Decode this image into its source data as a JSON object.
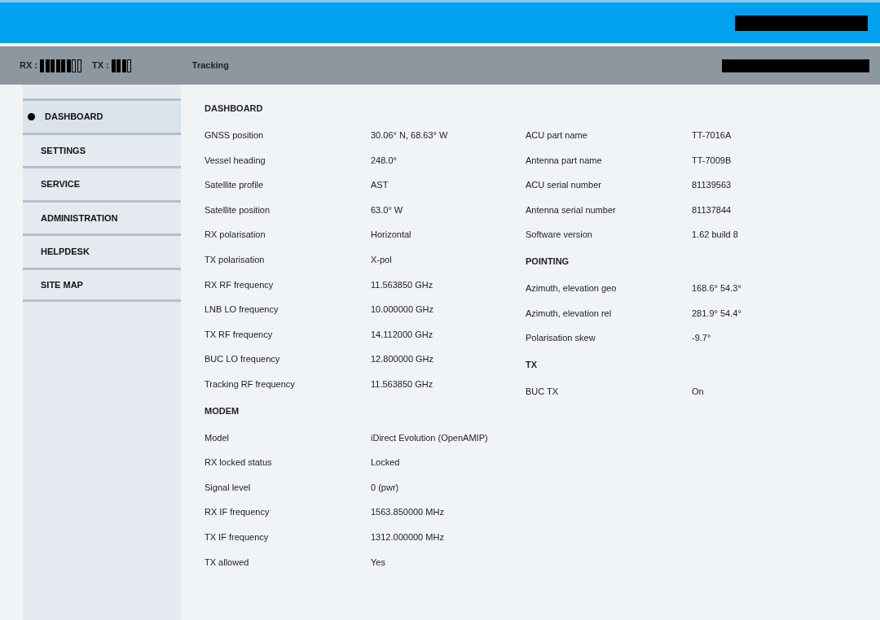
{
  "status_bar": {
    "meters": [
      {
        "label": "RX :",
        "segments": [
          {
            "filled": true
          },
          {
            "filled": true
          },
          {
            "filled": true
          },
          {
            "filled": true
          },
          {
            "filled": true
          },
          {
            "filled": true
          },
          {
            "filled": false
          },
          {
            "filled": false
          }
        ]
      },
      {
        "label": "TX :",
        "segments": [
          {
            "filled": true
          },
          {
            "filled": true
          },
          {
            "filled": true
          },
          {
            "filled": false
          }
        ]
      }
    ],
    "state": "Tracking"
  },
  "sidebar": {
    "items": [
      {
        "label": "DASHBOARD",
        "selected": true
      },
      {
        "label": "SETTINGS",
        "selected": false
      },
      {
        "label": "SERVICE",
        "selected": false
      },
      {
        "label": "ADMINISTRATION",
        "selected": false
      },
      {
        "label": "HELPDESK",
        "selected": false
      },
      {
        "label": "SITE MAP",
        "selected": false
      }
    ]
  },
  "columns": [
    {
      "sections": [
        {
          "heading": "DASHBOARD",
          "rows": [
            {
              "label": "GNSS position",
              "value": "30.06° N, 68.63° W"
            },
            {
              "label": "Vessel heading",
              "value": "248.0°"
            },
            {
              "label": "Satellite profile",
              "value": "AST"
            },
            {
              "label": "Satellite position",
              "value": "63.0° W"
            },
            {
              "label": "RX polarisation",
              "value": "Horizontal"
            },
            {
              "label": "TX polarisation",
              "value": "X-pol"
            },
            {
              "label": "RX RF frequency",
              "value": "11.563850 GHz"
            },
            {
              "label": "LNB LO frequency",
              "value": "10.000000 GHz"
            },
            {
              "label": "TX RF frequency",
              "value": "14.112000 GHz"
            },
            {
              "label": "BUC LO frequency",
              "value": "12.800000 GHz"
            },
            {
              "label": "Tracking RF frequency",
              "value": "11.563850 GHz"
            }
          ]
        },
        {
          "heading": "MODEM",
          "rows": [
            {
              "label": "Model",
              "value": "iDirect Evolution (OpenAMIP)"
            },
            {
              "label": "RX locked status",
              "value": "Locked"
            },
            {
              "label": "Signal level",
              "value": "0 (pwr)"
            },
            {
              "label": "RX IF frequency",
              "value": "1563.850000 MHz"
            },
            {
              "label": "TX IF frequency",
              "value": "1312.000000 MHz"
            },
            {
              "label": "TX allowed",
              "value": "Yes"
            }
          ]
        }
      ]
    },
    {
      "sections": [
        {
          "rows": [
            {
              "label": "ACU part name",
              "value": "TT-7016A"
            },
            {
              "label": "Antenna part name",
              "value": "TT-7009B"
            },
            {
              "label": "ACU serial number",
              "value": "81139563"
            },
            {
              "label": "Antenna serial number",
              "value": "81137844"
            },
            {
              "label": "Software version",
              "value": "1.62 build 8"
            }
          ]
        },
        {
          "heading": "POINTING",
          "rows": [
            {
              "label": "Azimuth, elevation geo",
              "value": "168.6° 54.3°"
            },
            {
              "label": "Azimuth, elevation rel",
              "value": "281.9° 54.4°"
            },
            {
              "label": "Polarisation skew",
              "value": "-9.7°"
            }
          ]
        },
        {
          "heading": "TX",
          "rows": [
            {
              "label": "BUC TX",
              "value": "On"
            }
          ]
        }
      ]
    }
  ]
}
